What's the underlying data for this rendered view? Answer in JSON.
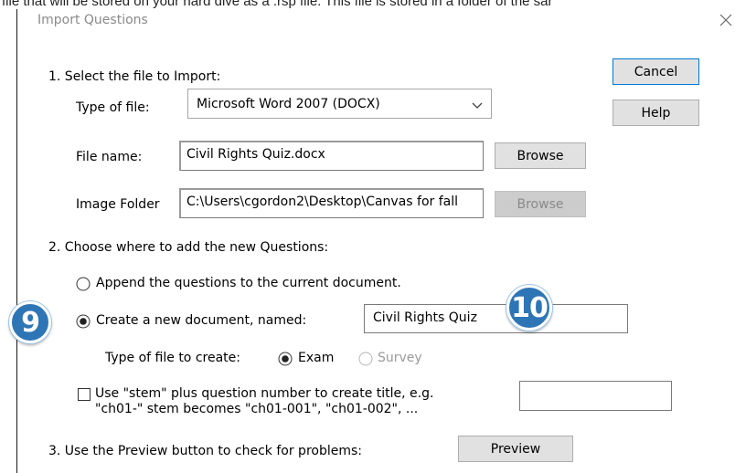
{
  "caption": "file that will be stored on your hard dive as a .rsp file. This file is stored in a folder of the sar",
  "dialog": {
    "title": "Import Questions"
  },
  "buttons": {
    "cancel": "Cancel",
    "help": "Help",
    "browse_file": "Browse",
    "browse_image": "Browse",
    "preview": "Preview"
  },
  "step1": {
    "label": "1. Select the file to Import:",
    "type_of_file_label": "Type of file:",
    "type_of_file_value": "Microsoft Word 2007 (DOCX)",
    "file_name_label": "File name:",
    "file_name_value": "Civil Rights Quiz.docx",
    "image_folder_label": "Image Folder",
    "image_folder_value": "C:\\Users\\cgordon2\\Desktop\\Canvas for fall"
  },
  "step2": {
    "label": "2. Choose where to add the new Questions:",
    "append_label": "Append the questions to the current document.",
    "create_label": "Create a new document, named:",
    "new_document_name": "Civil Rights Quiz",
    "type_to_create_label": "Type of file to create:",
    "exam_label": "Exam",
    "survey_label": "Survey",
    "stem_line1": "Use \"stem\" plus question number to create title,  e.g.",
    "stem_line2": "\"ch01-\" stem becomes \"ch01-001\",  \"ch01-002\",  ...",
    "stem_value": ""
  },
  "step3": {
    "label": "3. Use the Preview button to check for problems:"
  },
  "badges": {
    "step9": "9",
    "step10": "10"
  },
  "colors": {
    "badge": "#2e75b6",
    "focus": "#0078d7"
  }
}
